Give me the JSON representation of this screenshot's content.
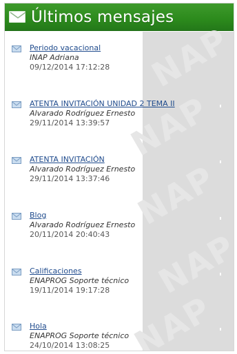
{
  "header": {
    "title": "Últimos mensajes",
    "icon": "envelope-icon",
    "background": "#2c8a1c"
  },
  "messages": [
    {
      "subject": "Periodo vacacional",
      "sender": "INAP Adriana",
      "date": "09/12/2014 17:12:28",
      "icon": "envelope-icon"
    },
    {
      "subject": "ATENTA INVITACIÓN UNIDAD 2 TEMA II",
      "sender": "Alvarado Rodríguez Ernesto",
      "date": "29/11/2014 13:39:57",
      "icon": "envelope-icon"
    },
    {
      "subject": "ATENTA INVITACIÓN",
      "sender": "Alvarado Rodríguez Ernesto",
      "date": "29/11/2014 13:37:46",
      "icon": "envelope-icon"
    },
    {
      "subject": "Blog",
      "sender": "Alvarado Rodríguez Ernesto",
      "date": "20/11/2014 20:40:43",
      "icon": "envelope-icon"
    },
    {
      "subject": "Calificaciones",
      "sender": "ENAPROG Soporte técnico",
      "date": "19/11/2014 19:17:28",
      "icon": "envelope-icon"
    },
    {
      "subject": "Hola",
      "sender": "ENAPROG Soporte técnico",
      "date": "24/10/2014 13:08:25",
      "icon": "envelope-icon"
    }
  ],
  "colors": {
    "link": "#1e4a8c",
    "panel_gray": "#dcdcdc",
    "header_green": "#2c8a1c"
  }
}
